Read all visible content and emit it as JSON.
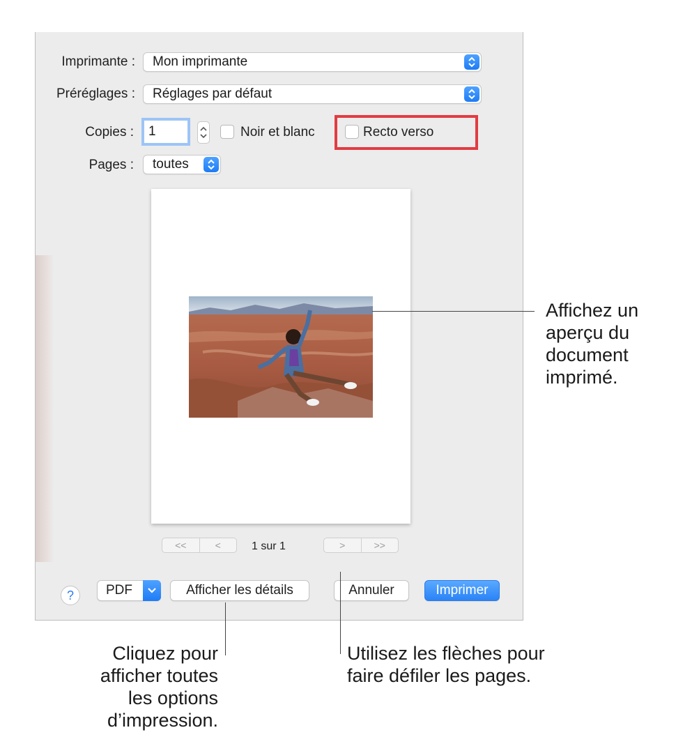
{
  "printer": {
    "label": "Imprimante :",
    "value": "Mon imprimante"
  },
  "presets": {
    "label": "Préréglages :",
    "value": "Réglages par défaut"
  },
  "copies": {
    "label": "Copies :",
    "value": "1"
  },
  "black_white": {
    "label": "Noir et blanc",
    "checked": false
  },
  "two_sided": {
    "label": "Recto verso",
    "checked": false
  },
  "pages": {
    "label": "Pages :",
    "value": "toutes"
  },
  "navigation": {
    "first": "<<",
    "prev": "<",
    "page_info": "1 sur 1",
    "next": ">",
    "last": ">>"
  },
  "buttons": {
    "help": "?",
    "pdf": "PDF",
    "details": "Afficher les détails",
    "cancel": "Annuler",
    "print": "Imprimer"
  },
  "callouts": {
    "preview": [
      "Affichez un",
      "aperçu du",
      "document",
      "imprimé."
    ],
    "details": [
      "Cliquez pour",
      "afficher toutes",
      "les options",
      "d’impression."
    ],
    "arrows": [
      "Utilisez les flèches pour",
      "faire défiler les pages."
    ]
  },
  "colors": {
    "accent": "#2a83f6",
    "highlight": "#e23c43"
  },
  "icons": {
    "popup": "up-down-chevron-icon",
    "pdf_menu": "chevron-down-icon",
    "help": "question-mark-icon"
  }
}
